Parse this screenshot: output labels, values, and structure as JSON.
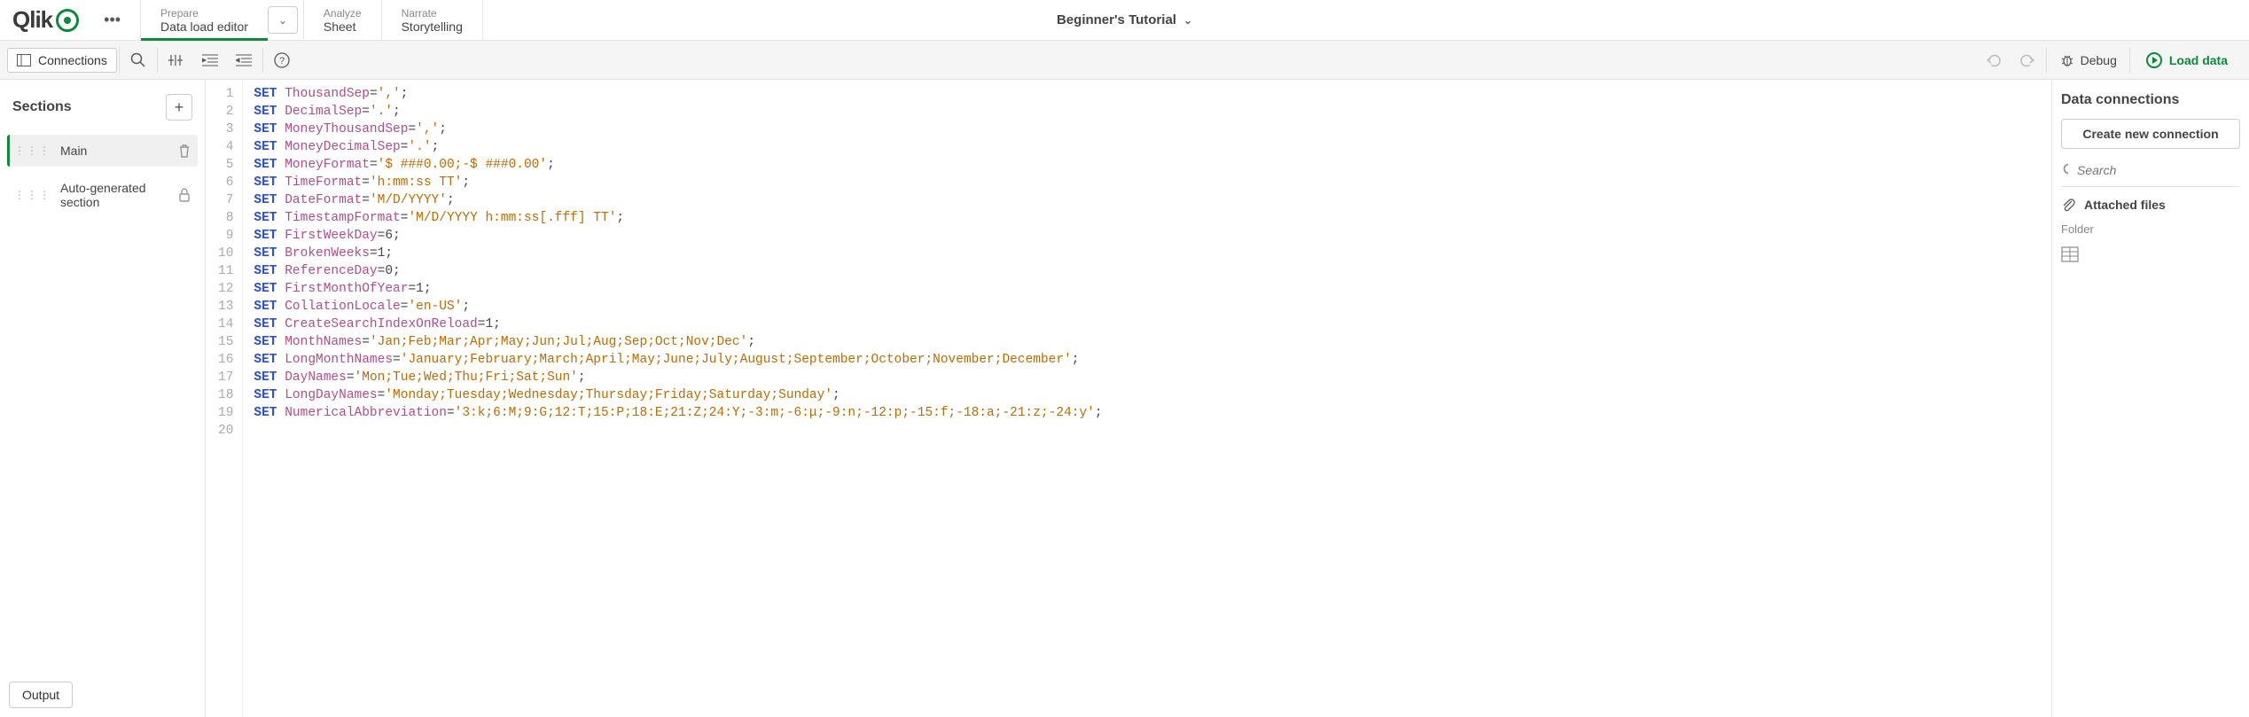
{
  "header": {
    "logo_text": "Qlik",
    "tabs": [
      {
        "sub": "Prepare",
        "main": "Data load editor",
        "active": true,
        "has_chevron": true
      },
      {
        "sub": "Analyze",
        "main": "Sheet",
        "active": false,
        "has_chevron": false
      },
      {
        "sub": "Narrate",
        "main": "Storytelling",
        "active": false,
        "has_chevron": false
      }
    ],
    "app_title": "Beginner's Tutorial"
  },
  "toolbar": {
    "connections_label": "Connections",
    "debug_label": "Debug",
    "load_data_label": "Load data"
  },
  "sections": {
    "title": "Sections",
    "items": [
      {
        "name": "Main",
        "active": true,
        "trailing_icon": "trash"
      },
      {
        "name": "Auto-generated section",
        "active": false,
        "trailing_icon": "lock"
      }
    ]
  },
  "output_label": "Output",
  "code_lines": [
    {
      "n": 1,
      "kw": "SET",
      "name": "ThousandSep",
      "eq": "=",
      "val": "','",
      "term": ";"
    },
    {
      "n": 2,
      "kw": "SET",
      "name": "DecimalSep",
      "eq": "=",
      "val": "'.'",
      "term": ";"
    },
    {
      "n": 3,
      "kw": "SET",
      "name": "MoneyThousandSep",
      "eq": "=",
      "val": "','",
      "term": ";"
    },
    {
      "n": 4,
      "kw": "SET",
      "name": "MoneyDecimalSep",
      "eq": "=",
      "val": "'.'",
      "term": ";"
    },
    {
      "n": 5,
      "kw": "SET",
      "name": "MoneyFormat",
      "eq": "=",
      "val": "'$ ###0.00;-$ ###0.00'",
      "term": ";"
    },
    {
      "n": 6,
      "kw": "SET",
      "name": "TimeFormat",
      "eq": "=",
      "val": "'h:mm:ss TT'",
      "term": ";"
    },
    {
      "n": 7,
      "kw": "SET",
      "name": "DateFormat",
      "eq": "=",
      "val": "'M/D/YYYY'",
      "term": ";"
    },
    {
      "n": 8,
      "kw": "SET",
      "name": "TimestampFormat",
      "eq": "=",
      "val": "'M/D/YYYY h:mm:ss[.fff] TT'",
      "term": ";"
    },
    {
      "n": 9,
      "kw": "SET",
      "name": "FirstWeekDay",
      "eq": "=",
      "val_plain": "6",
      "term": ";"
    },
    {
      "n": 10,
      "kw": "SET",
      "name": "BrokenWeeks",
      "eq": "=",
      "val_plain": "1",
      "term": ";"
    },
    {
      "n": 11,
      "kw": "SET",
      "name": "ReferenceDay",
      "eq": "=",
      "val_plain": "0",
      "term": ";"
    },
    {
      "n": 12,
      "kw": "SET",
      "name": "FirstMonthOfYear",
      "eq": "=",
      "val_plain": "1",
      "term": ";"
    },
    {
      "n": 13,
      "kw": "SET",
      "name": "CollationLocale",
      "eq": "=",
      "val": "'en-US'",
      "term": ";"
    },
    {
      "n": 14,
      "kw": "SET",
      "name": "CreateSearchIndexOnReload",
      "eq": "=",
      "val_plain": "1",
      "term": ";"
    },
    {
      "n": 15,
      "kw": "SET",
      "name": "MonthNames",
      "eq": "=",
      "val": "'Jan;Feb;Mar;Apr;May;Jun;Jul;Aug;Sep;Oct;Nov;Dec'",
      "term": ";"
    },
    {
      "n": 16,
      "kw": "SET",
      "name": "LongMonthNames",
      "eq": "=",
      "val": "'January;February;March;April;May;June;July;August;September;October;November;December'",
      "term": ";"
    },
    {
      "n": 17,
      "kw": "SET",
      "name": "DayNames",
      "eq": "=",
      "val": "'Mon;Tue;Wed;Thu;Fri;Sat;Sun'",
      "term": ";"
    },
    {
      "n": 18,
      "kw": "SET",
      "name": "LongDayNames",
      "eq": "=",
      "val": "'Monday;Tuesday;Wednesday;Thursday;Friday;Saturday;Sunday'",
      "term": ";"
    },
    {
      "n": 19,
      "kw": "SET",
      "name": "NumericalAbbreviation",
      "eq": "=",
      "val": "'3:k;6:M;9:G;12:T;15:P;18:E;21:Z;24:Y;-3:m;-6:μ;-9:n;-12:p;-15:f;-18:a;-21:z;-24:y'",
      "term": ";"
    },
    {
      "n": 20
    }
  ],
  "data_connections": {
    "title": "Data connections",
    "new_label": "Create new connection",
    "search_placeholder": "Search",
    "attached_label": "Attached files",
    "folder_label": "Folder"
  }
}
